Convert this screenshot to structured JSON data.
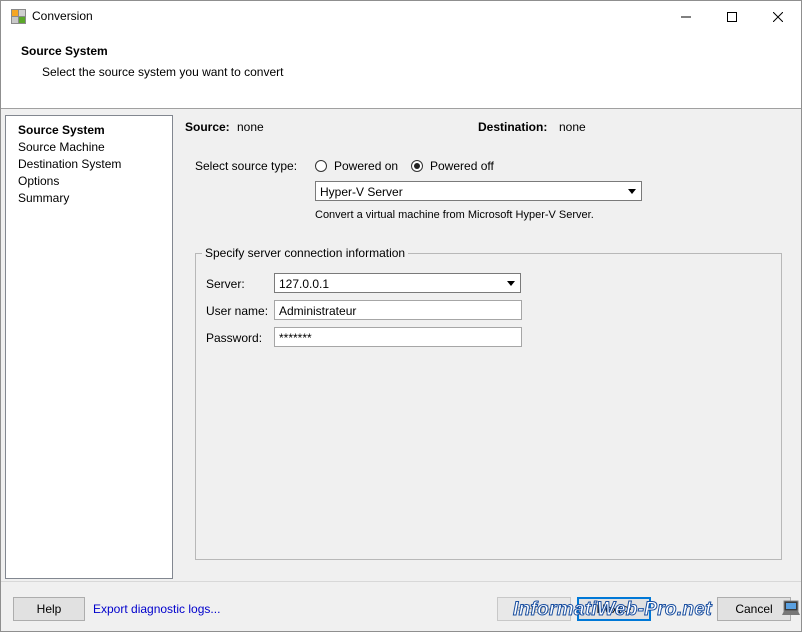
{
  "window": {
    "title": "Conversion"
  },
  "header": {
    "title": "Source System",
    "subtitle": "Select the source system you want to convert"
  },
  "nav": {
    "items": [
      {
        "label": "Source System",
        "active": true
      },
      {
        "label": "Source Machine",
        "active": false
      },
      {
        "label": "Destination System",
        "active": false
      },
      {
        "label": "Options",
        "active": false
      },
      {
        "label": "Summary",
        "active": false
      }
    ]
  },
  "summary": {
    "source_label": "Source:",
    "source_value": "none",
    "destination_label": "Destination:",
    "destination_value": "none"
  },
  "source_type": {
    "label": "Select source type:",
    "option_on": "Powered on",
    "option_off": "Powered off",
    "selected": "Powered off",
    "server_type": "Hyper-V Server",
    "description": "Convert a virtual machine from Microsoft Hyper-V Server."
  },
  "connection": {
    "legend": "Specify server connection information",
    "server_label": "Server:",
    "server_value": "127.0.0.1",
    "user_label": "User name:",
    "user_value": "Administrateur",
    "password_label": "Password:",
    "password_value": "*******"
  },
  "footer": {
    "help": "Help",
    "export_logs": "Export diagnostic logs...",
    "back": "< Back",
    "next": "Next >",
    "cancel": "Cancel"
  },
  "watermark": {
    "text": "InformatiWeb-Pro.net"
  }
}
